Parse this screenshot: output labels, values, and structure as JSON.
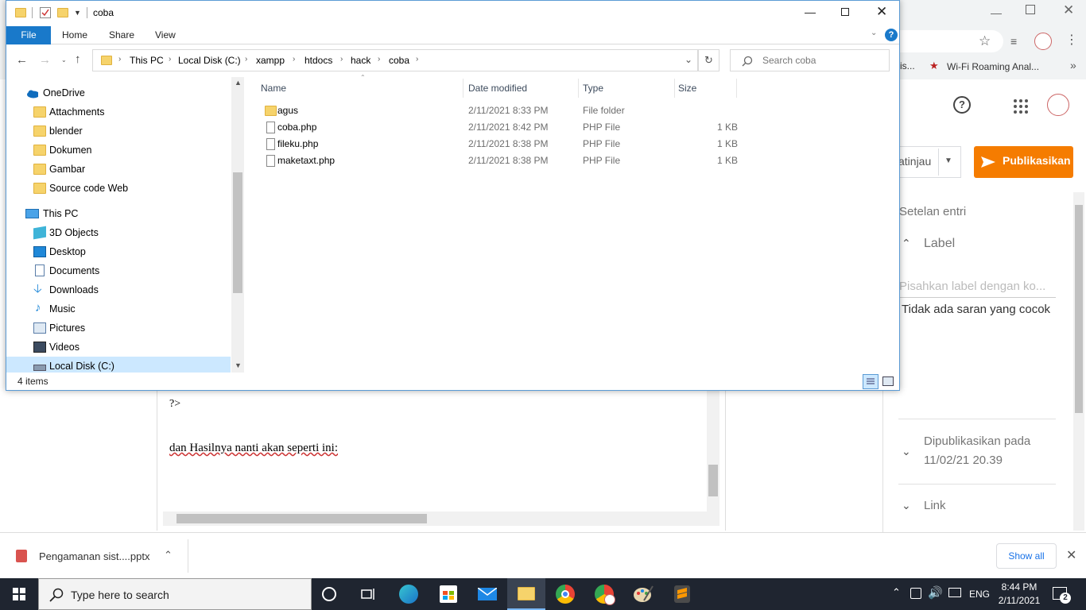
{
  "explorer": {
    "title": "coba",
    "ribbon_tabs": [
      "File",
      "Home",
      "Share",
      "View"
    ],
    "breadcrumb": [
      "This PC",
      "Local Disk (C:)",
      "xampp",
      "htdocs",
      "hack",
      "coba"
    ],
    "search_placeholder": "Search coba",
    "nav": {
      "onedrive": "OneDrive",
      "onedrive_items": [
        "Attachments",
        "blender",
        "Dokumen",
        "Gambar",
        "Source code Web"
      ],
      "thispc": "This PC",
      "thispc_items": [
        "3D Objects",
        "Desktop",
        "Documents",
        "Downloads",
        "Music",
        "Pictures",
        "Videos",
        "Local Disk (C:)"
      ]
    },
    "columns": {
      "name": "Name",
      "date": "Date modified",
      "type": "Type",
      "size": "Size"
    },
    "files": [
      {
        "name": "agus",
        "date": "2/11/2021 8:33 PM",
        "type": "File folder",
        "size": ""
      },
      {
        "name": "coba.php",
        "date": "2/11/2021 8:42 PM",
        "type": "PHP File",
        "size": "1 KB"
      },
      {
        "name": "fileku.php",
        "date": "2/11/2021 8:38 PM",
        "type": "PHP File",
        "size": "1 KB"
      },
      {
        "name": "maketaxt.php",
        "date": "2/11/2021 8:38 PM",
        "type": "PHP File",
        "size": "1 KB"
      }
    ],
    "status": "4 items"
  },
  "browser": {
    "bookmark": "Wi-Fi Roaming Anal...",
    "bookmark_prefix": "is...",
    "preview_label": "atinjau",
    "publish_label": "Publikasikan",
    "settings_title": "Setelan entri",
    "label_section": "Label",
    "label_placeholder": "Pisahkan label dengan ko...",
    "no_suggestion": "Tidak ada saran yang cocok",
    "published_title": "Dipublikasikan pada",
    "published_date": "11/02/21 20.39",
    "link_section": "Link",
    "editor_code": "?>",
    "editor_text": "dan Hasilnya nanti akan seperti ini:",
    "download_file": "Pengamanan sist....pptx",
    "show_all": "Show all",
    "accent_color": "#f57c00"
  },
  "taskbar": {
    "search_placeholder": "Type here to search",
    "lang": "ENG",
    "time": "8:44 PM",
    "date": "2/11/2021",
    "notifications": "2"
  }
}
